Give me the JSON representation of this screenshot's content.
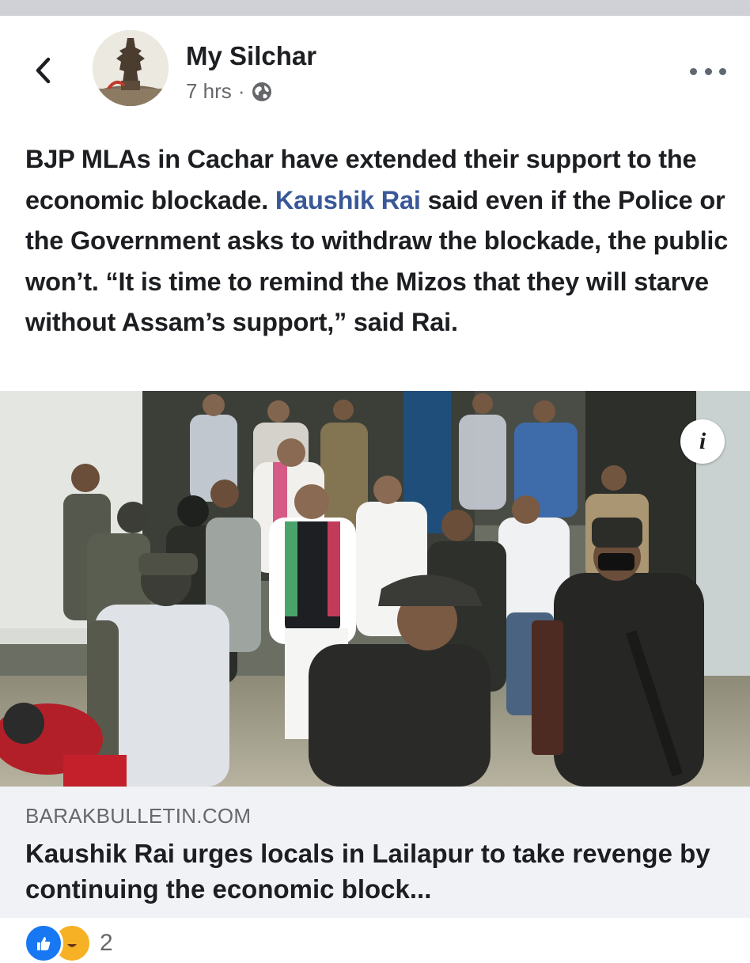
{
  "header": {
    "page_name": "My Silchar",
    "time_ago": "7 hrs",
    "separator": "·",
    "privacy_icon": "globe-icon",
    "back_icon": "chevron-left-icon",
    "more_icon": "more-dots-icon"
  },
  "post": {
    "text_before": "BJP MLAs in Cachar have extended their support to the economic blockade. ",
    "mention": "Kaushik Rai",
    "text_after": " said even if the Police or the Government asks to withdraw the blockade, the public won’t. “It is time to remind the Mizos that they will starve without Assam’s support,” said Rai."
  },
  "photo": {
    "info_label": "i"
  },
  "link_preview": {
    "domain": "BARAKBULLETIN.COM",
    "title": "Kaushik Rai urges locals in Lailapur to take revenge by continuing the economic block..."
  },
  "reactions": {
    "count": "2",
    "icons": [
      "like-icon",
      "haha-icon"
    ]
  },
  "colors": {
    "mention": "#385898",
    "secondary_text": "#65676b",
    "link_box_bg": "#f0f2f5",
    "like_blue": "#1877f2",
    "haha_yellow": "#f7b125"
  }
}
